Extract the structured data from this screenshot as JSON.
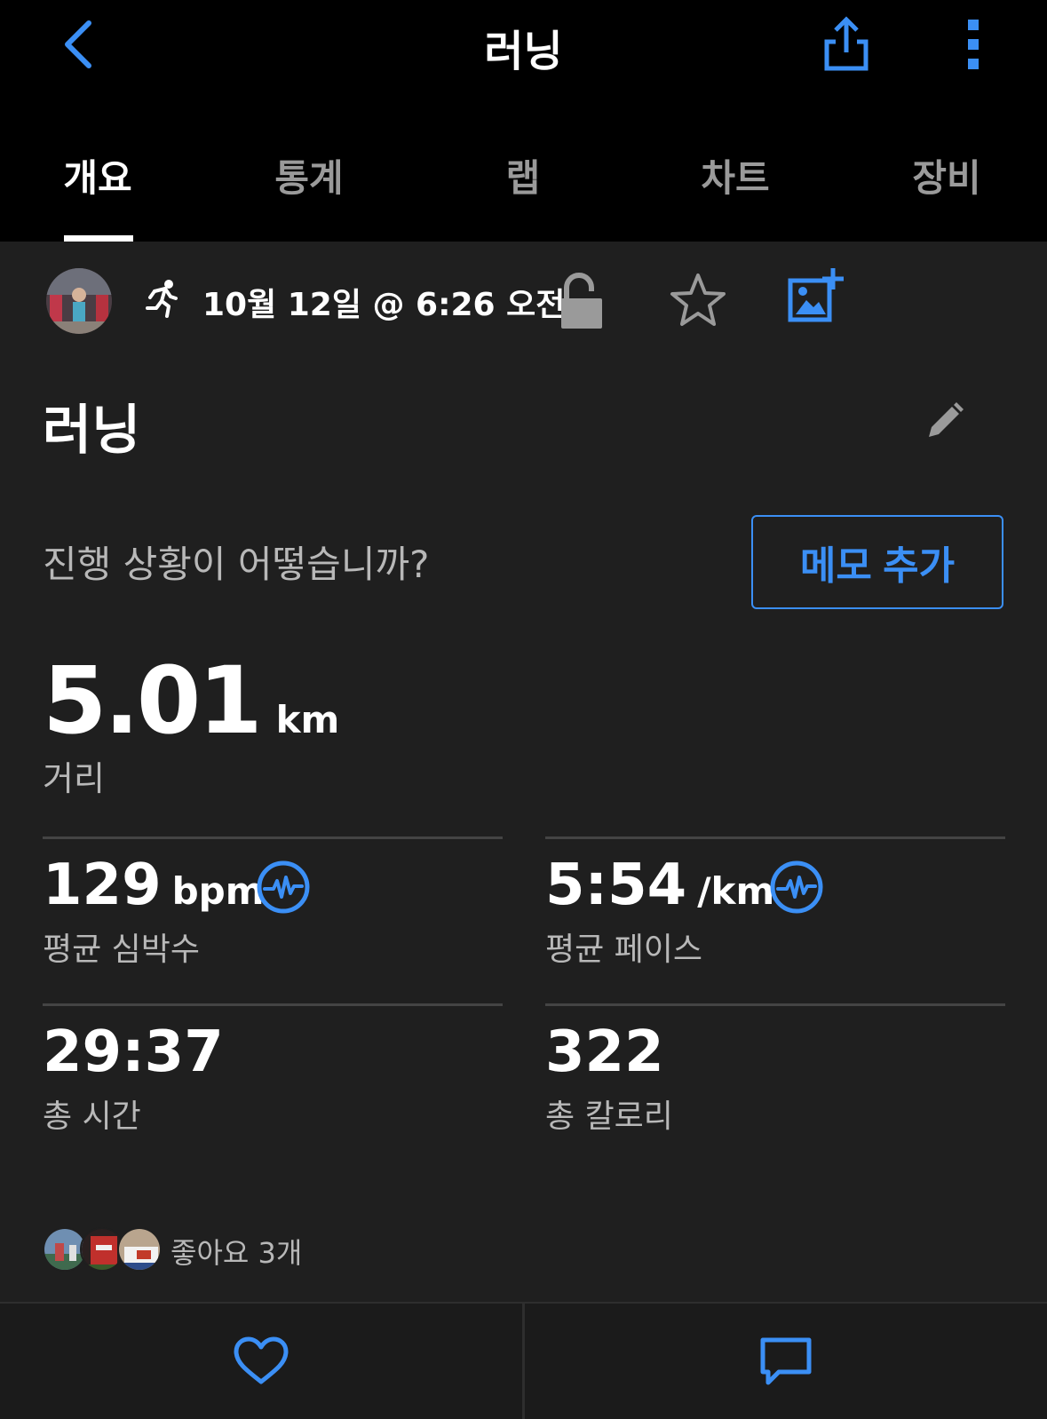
{
  "colors": {
    "accent": "#3b8ff5",
    "background": "#1f1f1f",
    "header_bg": "#000000",
    "muted_text": "#b8b8b8"
  },
  "header": {
    "title": "러닝",
    "back_icon": "chevron-left-icon",
    "share_icon": "share-icon",
    "more_icon": "more-vertical-icon"
  },
  "tabs": [
    {
      "label": "개요",
      "active": true
    },
    {
      "label": "통계",
      "active": false
    },
    {
      "label": "랩",
      "active": false
    },
    {
      "label": "차트",
      "active": false
    },
    {
      "label": "장비",
      "active": false
    }
  ],
  "activity": {
    "type_icon": "running-icon",
    "date": "10월 12일 @ 6:26 오전",
    "name": "러닝",
    "privacy_icon": "unlock-icon",
    "favorite_icon": "star-icon",
    "add_photo_icon": "add-photo-icon",
    "edit_icon": "pencil-icon"
  },
  "prompt": {
    "question": "진행 상황이 어떻습니까?",
    "memo_button": "메모 추가"
  },
  "distance": {
    "value": "5.01",
    "unit": "km",
    "label": "거리"
  },
  "stats": [
    {
      "value": "129",
      "unit": "bpm",
      "label": "평균 심박수",
      "icon": "heart-rate-icon"
    },
    {
      "value": "5:54",
      "unit": "/km",
      "label": "평균 페이스",
      "icon": "heart-rate-icon"
    },
    {
      "value": "29:37",
      "unit": "",
      "label": "총 시간"
    },
    {
      "value": "322",
      "unit": "",
      "label": "총 칼로리"
    }
  ],
  "likes": {
    "text": "좋아요 3개"
  },
  "footer": {
    "like_icon": "heart-icon",
    "comment_icon": "comment-icon"
  }
}
